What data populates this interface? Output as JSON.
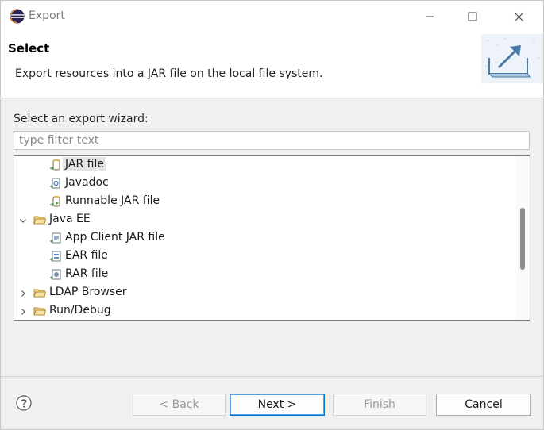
{
  "window": {
    "title": "Export"
  },
  "window_controls": {
    "minimize": "—",
    "maximize": "☐",
    "close": "✕"
  },
  "header": {
    "title": "Select",
    "description": "Export resources into a JAR file on the local file system."
  },
  "wizard_list": {
    "label": "Select an export wizard:",
    "filter_placeholder": "type filter text",
    "items": [
      {
        "label": "JAR file",
        "kind": "item",
        "icon": "jar-file-icon",
        "selected": true
      },
      {
        "label": "Javadoc",
        "kind": "item",
        "icon": "javadoc-icon",
        "selected": false
      },
      {
        "label": "Runnable JAR file",
        "kind": "item",
        "icon": "runnable-jar-icon",
        "selected": false
      },
      {
        "label": "Java EE",
        "kind": "folder",
        "expanded": true,
        "icon": "folder-icon"
      },
      {
        "label": "App Client JAR file",
        "kind": "item",
        "icon": "app-client-jar-icon",
        "selected": false
      },
      {
        "label": "EAR file",
        "kind": "item",
        "icon": "ear-file-icon",
        "selected": false
      },
      {
        "label": "RAR file",
        "kind": "item",
        "icon": "rar-file-icon",
        "selected": false
      },
      {
        "label": "LDAP Browser",
        "kind": "folder",
        "expanded": false,
        "icon": "folder-icon"
      },
      {
        "label": "Run/Debug",
        "kind": "folder",
        "expanded": false,
        "icon": "folder-icon"
      }
    ]
  },
  "buttons": {
    "back": "< Back",
    "next": "Next >",
    "finish": "Finish",
    "cancel": "Cancel"
  },
  "colors": {
    "accent": "#0078d4",
    "selection": "#e5e5e5",
    "folder": "#e8b94a"
  }
}
